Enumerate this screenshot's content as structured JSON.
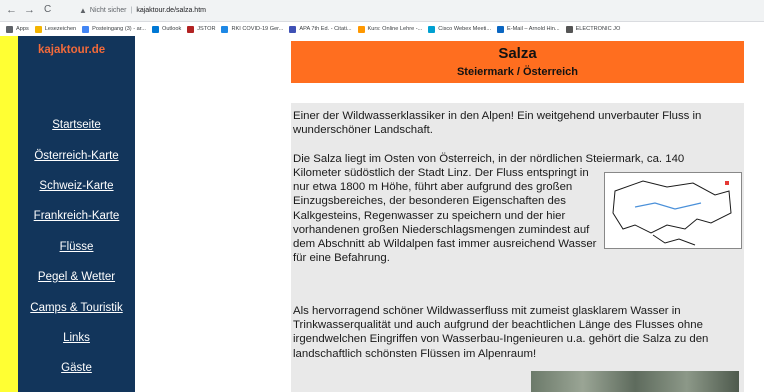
{
  "browser": {
    "back_label": "←",
    "forward_label": "→",
    "reload_label": "C",
    "security_label": "Nicht sicher",
    "url": "kajaktour.de/salza.htm"
  },
  "bookmarks": [
    {
      "label": "Apps",
      "color": "#5f6368"
    },
    {
      "label": "Lesezeichen",
      "color": "#f4b400"
    },
    {
      "label": "Posteingang (3) - ar...",
      "color": "#4285f4"
    },
    {
      "label": "Outlook",
      "color": "#0078d4"
    },
    {
      "label": "JSTOR",
      "color": "#b22222"
    },
    {
      "label": "RKI COVID-19 Ger...",
      "color": "#1e88e5"
    },
    {
      "label": "APA 7th Ed. - Citati...",
      "color": "#3f51b5"
    },
    {
      "label": "Kurs: Online Lehre -...",
      "color": "#ff9800"
    },
    {
      "label": "Cisco Webex Meeti...",
      "color": "#00a0d1"
    },
    {
      "label": "E-Mail – Arnold Hin...",
      "color": "#0a66c2"
    },
    {
      "label": "ELECTRONIC JO",
      "color": "#555555"
    }
  ],
  "site": {
    "name": "kajaktour.de"
  },
  "nav": [
    {
      "label": "Startseite"
    },
    {
      "label": "Österreich-Karte"
    },
    {
      "label": "Schweiz-Karte"
    },
    {
      "label": "Frankreich-Karte"
    },
    {
      "label": "Flüsse"
    },
    {
      "label": "Pegel & Wetter"
    },
    {
      "label": "Camps & Touristik"
    },
    {
      "label": "Links"
    },
    {
      "label": "Gäste"
    }
  ],
  "header": {
    "title": "Salza",
    "subtitle": "Steiermark / Österreich"
  },
  "content": {
    "p1": "Einer der Wildwasserklassiker in den Alpen! Ein weitgehend unverbauter Fluss in wunderschöner Landschaft.",
    "p2_full": "Die Salza liegt im Osten von Österreich, in der nördlichen Steiermark, ca. 140",
    "p2_wrap": "Kilometer südöstlich der Stadt Linz. Der Fluss entspringt in nur etwa 1800 m Höhe, führt aber aufgrund des großen Einzugsbereiches, der besonderen Eigenschaften des Kalkgesteins, Regenwasser zu speichern und der hier vorhandenen großen Niederschlagsmengen zumindest auf dem Abschnitt ab Wildalpen fast immer ausreichend Wasser für eine Befahrung.",
    "p3": "Als hervorragend schöner Wildwasserfluss mit zumeist glasklarem Wasser in Trinkwasserqualität und auch aufgrund der beachtlichen Länge des Flusses ohne irgendwelchen Eingriffen von Wasserbau-Ingenieuren u.a. gehört die Salza zu den landschaftlich schönsten Flüssen im Alpenraum!"
  },
  "colors": {
    "sidebar": "#12355b",
    "accent_strip": "#ffff33",
    "header": "#ff6e1f",
    "site_name": "#f26a3a",
    "text_box": "#e9e9e9"
  }
}
